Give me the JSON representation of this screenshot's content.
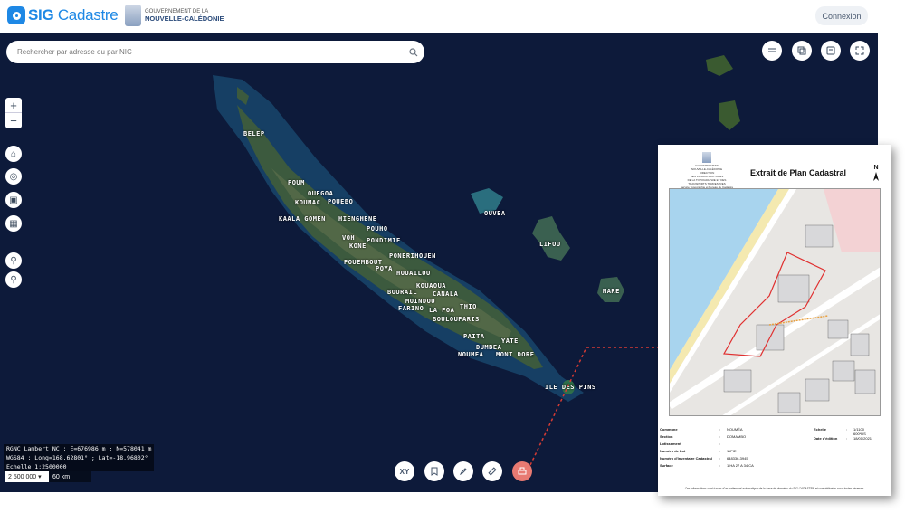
{
  "header": {
    "logo_text": "SIG",
    "logo_text2": "Cadastre",
    "gov_line1": "GOUVERNEMENT DE LA",
    "gov_line2": "NOUVELLE-CALÉDONIE",
    "login_label": "Connexion"
  },
  "search": {
    "placeholder": "Rechercher par adresse ou par NIC"
  },
  "map": {
    "places": [
      "BELEP",
      "POUM",
      "OUEGOA",
      "KOUMAC",
      "POUEBO",
      "KAALA GOMEN",
      "HIENGHENE",
      "VOH",
      "POUHO",
      "KONE",
      "PONDIMIE",
      "POUEMBOUT",
      "PONERIHOUEN",
      "POYA",
      "HOUAILOU",
      "KOUAOUA",
      "BOURAIL",
      "CANALA",
      "MOINDOU",
      "THIO",
      "FARINO",
      "LA FOA",
      "BOULOUPARIS",
      "PAITA",
      "YATE",
      "DUMBEA",
      "NOUMEA",
      "MONT DORE",
      "ILE DES PINS",
      "OUVEA",
      "LIFOU",
      "MARE"
    ],
    "coords_line1": "RGNC Lambert NC : E=676986 m ; N=578041 m",
    "coords_line2": "WGS84 : Long=168.62801° ; Lat=-18.96802°",
    "coords_line3": "Echelle 1:2500000",
    "scale_select": "2 500 000",
    "scale_km": "60 km",
    "coordinate_tool": "XY"
  },
  "extract": {
    "gov_line1": "GOUVERNEMENT",
    "gov_line2": "NOUVELLE-CALÉDONIE",
    "gov_line3": "DIRECTION",
    "gov_line4": "DES INFRASTRUCTURES",
    "gov_line5": "DE LA TOPOGRAPHIE ET DES",
    "gov_line6": "TRANSPORTS TERRESTRES",
    "gov_line7": "Service Topographie et Bureau du Cadastre",
    "title": "Extrait de Plan Cadastral",
    "north": "N",
    "commune_label": "Commune",
    "commune_value": "NOUMÉA",
    "section_label": "Section",
    "section_value": "DOMAMBO",
    "lotissement_label": "Lotissement",
    "lotissement_value": "",
    "lot_label": "Numéro de Lot",
    "lot_value": "11PIE",
    "nic_label": "Numéro d'Inventaire Cadastral",
    "nic_value": "648336-3945",
    "surface_label": "Surface",
    "surface_value": "1 HA 27 A 34 CA",
    "echelle_label": "Echelle",
    "echelle_value": "1/1100",
    "echelle_sub": "600*DS",
    "date_label": "Date d'édition",
    "date_value": "18/01/2021",
    "note": "Ces informations sont issues d'un traitement automatique de la base de données du SIG CADASTRE et sont délivrées sous toutes réserves."
  }
}
